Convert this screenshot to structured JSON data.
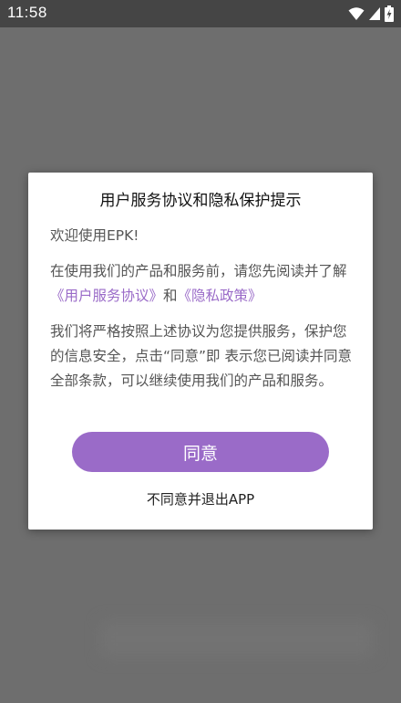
{
  "status_bar": {
    "time": "11:58",
    "icons": [
      "wifi-icon",
      "cellular-signal-icon",
      "battery-charging-icon"
    ]
  },
  "dialog": {
    "title": "用户服务协议和隐私保护提示",
    "welcome": "欢迎使用EPK!",
    "intro_prefix": "在使用我们的产品和服务前，请您先阅读并了解",
    "user_agreement_link": "《用户服务协议》",
    "and_text": "和",
    "privacy_policy_link": "《隐私政策》",
    "commitment": "我们将严格按照上述协议为您提供服务，保护您的信息安全，点击“同意”即 表示您已阅读并同意全部条款，可以继续使用我们的产品和服务。",
    "agree_button": "同意",
    "disagree_exit": "不同意并退出APP"
  },
  "colors": {
    "accent": "#9a6bc8",
    "overlay": "#6e6e6e",
    "status_bar": "#454545"
  }
}
